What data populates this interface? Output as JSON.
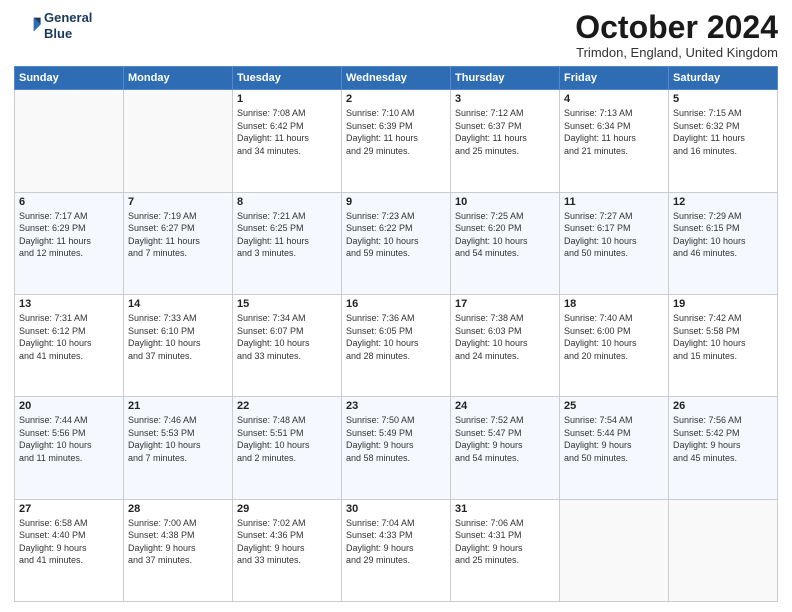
{
  "header": {
    "logo_line1": "General",
    "logo_line2": "Blue",
    "month": "October 2024",
    "location": "Trimdon, England, United Kingdom"
  },
  "days_of_week": [
    "Sunday",
    "Monday",
    "Tuesday",
    "Wednesday",
    "Thursday",
    "Friday",
    "Saturday"
  ],
  "weeks": [
    [
      {
        "day": "",
        "info": ""
      },
      {
        "day": "",
        "info": ""
      },
      {
        "day": "1",
        "info": "Sunrise: 7:08 AM\nSunset: 6:42 PM\nDaylight: 11 hours\nand 34 minutes."
      },
      {
        "day": "2",
        "info": "Sunrise: 7:10 AM\nSunset: 6:39 PM\nDaylight: 11 hours\nand 29 minutes."
      },
      {
        "day": "3",
        "info": "Sunrise: 7:12 AM\nSunset: 6:37 PM\nDaylight: 11 hours\nand 25 minutes."
      },
      {
        "day": "4",
        "info": "Sunrise: 7:13 AM\nSunset: 6:34 PM\nDaylight: 11 hours\nand 21 minutes."
      },
      {
        "day": "5",
        "info": "Sunrise: 7:15 AM\nSunset: 6:32 PM\nDaylight: 11 hours\nand 16 minutes."
      }
    ],
    [
      {
        "day": "6",
        "info": "Sunrise: 7:17 AM\nSunset: 6:29 PM\nDaylight: 11 hours\nand 12 minutes."
      },
      {
        "day": "7",
        "info": "Sunrise: 7:19 AM\nSunset: 6:27 PM\nDaylight: 11 hours\nand 7 minutes."
      },
      {
        "day": "8",
        "info": "Sunrise: 7:21 AM\nSunset: 6:25 PM\nDaylight: 11 hours\nand 3 minutes."
      },
      {
        "day": "9",
        "info": "Sunrise: 7:23 AM\nSunset: 6:22 PM\nDaylight: 10 hours\nand 59 minutes."
      },
      {
        "day": "10",
        "info": "Sunrise: 7:25 AM\nSunset: 6:20 PM\nDaylight: 10 hours\nand 54 minutes."
      },
      {
        "day": "11",
        "info": "Sunrise: 7:27 AM\nSunset: 6:17 PM\nDaylight: 10 hours\nand 50 minutes."
      },
      {
        "day": "12",
        "info": "Sunrise: 7:29 AM\nSunset: 6:15 PM\nDaylight: 10 hours\nand 46 minutes."
      }
    ],
    [
      {
        "day": "13",
        "info": "Sunrise: 7:31 AM\nSunset: 6:12 PM\nDaylight: 10 hours\nand 41 minutes."
      },
      {
        "day": "14",
        "info": "Sunrise: 7:33 AM\nSunset: 6:10 PM\nDaylight: 10 hours\nand 37 minutes."
      },
      {
        "day": "15",
        "info": "Sunrise: 7:34 AM\nSunset: 6:07 PM\nDaylight: 10 hours\nand 33 minutes."
      },
      {
        "day": "16",
        "info": "Sunrise: 7:36 AM\nSunset: 6:05 PM\nDaylight: 10 hours\nand 28 minutes."
      },
      {
        "day": "17",
        "info": "Sunrise: 7:38 AM\nSunset: 6:03 PM\nDaylight: 10 hours\nand 24 minutes."
      },
      {
        "day": "18",
        "info": "Sunrise: 7:40 AM\nSunset: 6:00 PM\nDaylight: 10 hours\nand 20 minutes."
      },
      {
        "day": "19",
        "info": "Sunrise: 7:42 AM\nSunset: 5:58 PM\nDaylight: 10 hours\nand 15 minutes."
      }
    ],
    [
      {
        "day": "20",
        "info": "Sunrise: 7:44 AM\nSunset: 5:56 PM\nDaylight: 10 hours\nand 11 minutes."
      },
      {
        "day": "21",
        "info": "Sunrise: 7:46 AM\nSunset: 5:53 PM\nDaylight: 10 hours\nand 7 minutes."
      },
      {
        "day": "22",
        "info": "Sunrise: 7:48 AM\nSunset: 5:51 PM\nDaylight: 10 hours\nand 2 minutes."
      },
      {
        "day": "23",
        "info": "Sunrise: 7:50 AM\nSunset: 5:49 PM\nDaylight: 9 hours\nand 58 minutes."
      },
      {
        "day": "24",
        "info": "Sunrise: 7:52 AM\nSunset: 5:47 PM\nDaylight: 9 hours\nand 54 minutes."
      },
      {
        "day": "25",
        "info": "Sunrise: 7:54 AM\nSunset: 5:44 PM\nDaylight: 9 hours\nand 50 minutes."
      },
      {
        "day": "26",
        "info": "Sunrise: 7:56 AM\nSunset: 5:42 PM\nDaylight: 9 hours\nand 45 minutes."
      }
    ],
    [
      {
        "day": "27",
        "info": "Sunrise: 6:58 AM\nSunset: 4:40 PM\nDaylight: 9 hours\nand 41 minutes."
      },
      {
        "day": "28",
        "info": "Sunrise: 7:00 AM\nSunset: 4:38 PM\nDaylight: 9 hours\nand 37 minutes."
      },
      {
        "day": "29",
        "info": "Sunrise: 7:02 AM\nSunset: 4:36 PM\nDaylight: 9 hours\nand 33 minutes."
      },
      {
        "day": "30",
        "info": "Sunrise: 7:04 AM\nSunset: 4:33 PM\nDaylight: 9 hours\nand 29 minutes."
      },
      {
        "day": "31",
        "info": "Sunrise: 7:06 AM\nSunset: 4:31 PM\nDaylight: 9 hours\nand 25 minutes."
      },
      {
        "day": "",
        "info": ""
      },
      {
        "day": "",
        "info": ""
      }
    ]
  ]
}
